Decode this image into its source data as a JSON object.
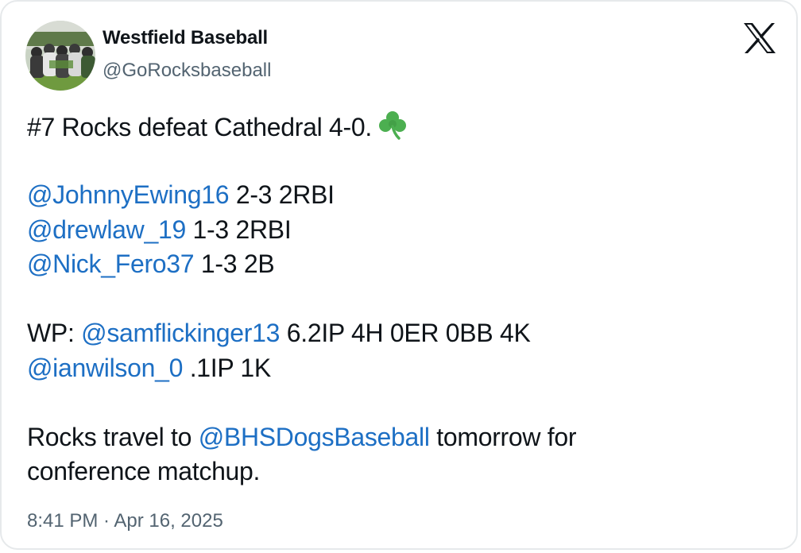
{
  "author": {
    "display_name": "Westfield Baseball",
    "handle": "@GoRocksbaseball",
    "avatar_icon": "team-photo-avatar"
  },
  "platform_icon": "x-logo-icon",
  "tweet": {
    "line1": {
      "text": "#7 Rocks defeat Cathedral 4-0.",
      "emoji": "shamrock-icon"
    },
    "stats": [
      {
        "mention": "@JohnnyEwing16",
        "text": " 2-3 2RBI"
      },
      {
        "mention": "@drewlaw_19",
        "text": " 1-3 2RBI"
      },
      {
        "mention": "@Nick_Fero37",
        "text": " 1-3 2B"
      }
    ],
    "pitching": {
      "wp_prefix": "WP: ",
      "wp_mention": "@samflickinger13",
      "wp_text": " 6.2IP 4H 0ER 0BB 4K",
      "relief_mention": "@ianwilson_0",
      "relief_text": " .1IP 1K"
    },
    "closing": {
      "prefix": "Rocks travel to ",
      "mention": "@BHSDogsBaseball",
      "suffix": " tomorrow for",
      "line2": "conference matchup."
    }
  },
  "timestamp": "8:41 PM · Apr 16, 2025",
  "colors": {
    "link": "#1d6fc4",
    "text": "#0f1419",
    "muted": "#536471",
    "border": "#e6e9eb",
    "shamrock": "#4caf50"
  }
}
